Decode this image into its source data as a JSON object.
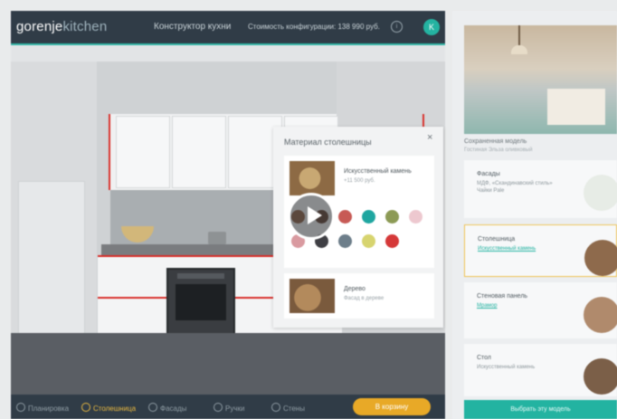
{
  "header": {
    "logo_main": "gorenje",
    "logo_accent": "kitchen",
    "title": "Конструктор кухни",
    "cost": "Стоимость конфигурации: 138 990 руб.",
    "info_glyph": "i",
    "user_initial": "K"
  },
  "bottom_nav": {
    "items": [
      {
        "label": "Планировка",
        "active": false
      },
      {
        "label": "Столешница",
        "active": true
      },
      {
        "label": "Фасады",
        "active": false
      },
      {
        "label": "Ручки",
        "active": false
      },
      {
        "label": "Стены",
        "active": false
      }
    ],
    "order_label": "В корзину"
  },
  "popup": {
    "title": "Материал столешницы",
    "close_glyph": "×",
    "material1": {
      "name": "Искусственный камень",
      "sub": "+11 500 руб."
    },
    "material2": {
      "name": "Дерево",
      "sub": "Фасад в дереве"
    },
    "swatch_colors": [
      "#9a6b4e",
      "#6b4a3a",
      "#c75a55",
      "#1fa6a0",
      "#8c9a55",
      "#edc8cf",
      "#d99aa0",
      "#3f3f44",
      "#6d7e8a",
      "#d7d46f",
      "#d53838"
    ]
  },
  "right_panel": {
    "saved_title": "Сохраненная модель",
    "saved_sub": "Гостиная Эльза оливковый",
    "cards": [
      {
        "title": "Фасады",
        "sub": "МДФ, «Скандинавский стиль»\nЧайки Pale",
        "circle": "#e7ece6",
        "link": false
      },
      {
        "title": "Столешница",
        "sub": "Искусственный камень",
        "circle": "#8e6a4c",
        "link": true
      },
      {
        "title": "Стеновая панель",
        "sub": "Мрамор",
        "circle": "#b08a6c",
        "link": true
      },
      {
        "title": "Стол",
        "sub": "Искусственный камень",
        "circle": "#7b5f48",
        "link": false
      }
    ],
    "button_label": "Выбрать эту модель"
  },
  "colors": {
    "header_bg": "#303c47",
    "accent_teal": "#23b3a1",
    "accent_orange": "#e8a927",
    "cabinet_red": "#d8302b"
  }
}
